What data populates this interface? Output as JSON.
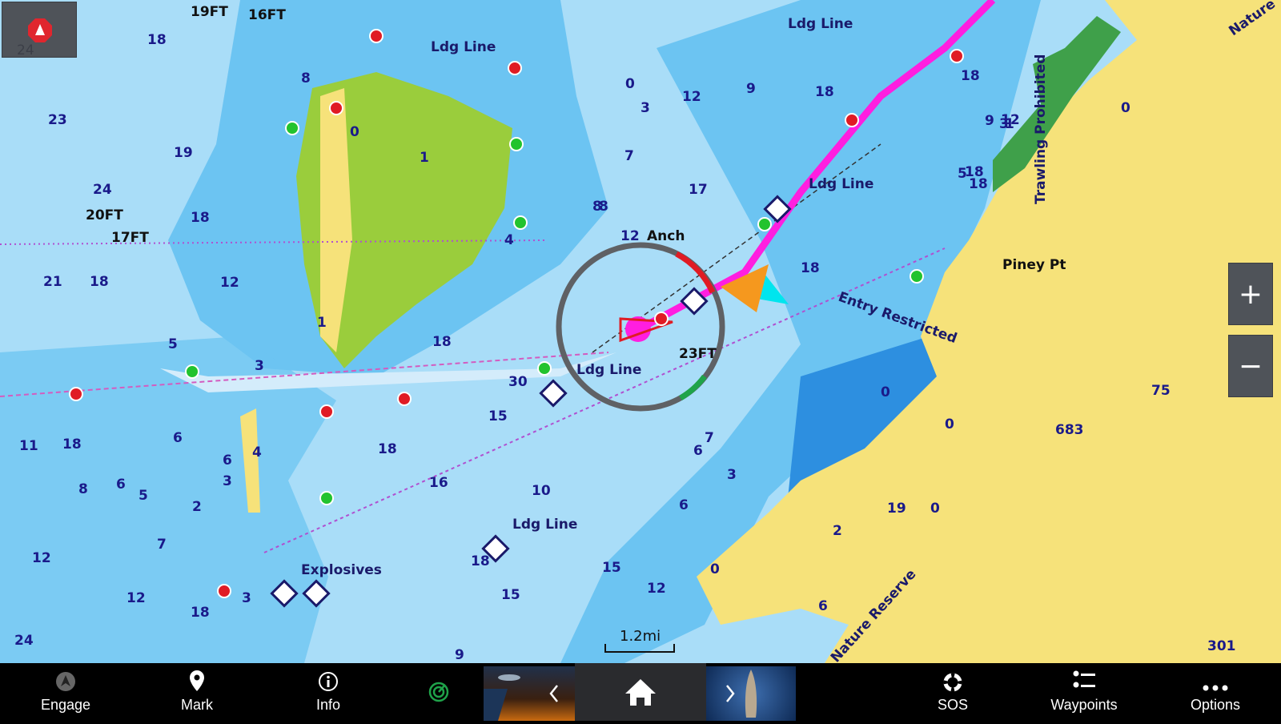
{
  "map": {
    "soundings": [
      "18",
      "23",
      "19",
      "24",
      "18",
      "21",
      "18",
      "12",
      "8",
      "8",
      "1",
      "0",
      "3",
      "0",
      "7",
      "12",
      "9",
      "18",
      "8",
      "17",
      "12",
      "18",
      "9",
      "12",
      "3",
      "18",
      "5",
      "1",
      "0",
      "4",
      "5",
      "3",
      "1",
      "18",
      "15",
      "30",
      "18",
      "6",
      "11",
      "18",
      "8",
      "6",
      "5",
      "4",
      "6",
      "3",
      "2",
      "7",
      "12",
      "12",
      "24",
      "18",
      "16",
      "10",
      "6",
      "7",
      "6",
      "15",
      "12",
      "15",
      "18",
      "9",
      "3",
      "18",
      "0",
      "0",
      "19",
      "0",
      "683",
      "75",
      "301",
      "6",
      "3",
      "0",
      "2",
      "18"
    ],
    "depth_ft_labels": [
      "19FT",
      "16FT",
      "20FT",
      "17FT",
      "23FT"
    ],
    "feature_labels": {
      "ldg_line_1": "Ldg Line",
      "ldg_line_2": "Ldg Line",
      "ldg_line_3": "Ldg Line",
      "ldg_line_4": "Ldg Line",
      "ldg_line_5": "Ldg Line",
      "anch": "Anch",
      "explosives": "Explosives",
      "entry_restricted": "Entry Restricted",
      "piney_pt": "Piney Pt",
      "trawling_prohibited": "Trawling Prohibited",
      "nature_reserve": "Nature Reserve",
      "nature_top": "Nature"
    },
    "scale": "1.2mi",
    "ghost_depth": "24",
    "colors": {
      "land": "#f6e27a",
      "shallow": "#6cc4f2",
      "deep": "#a9ddf8",
      "marsh": "#9acd3c",
      "route": "#ff1ee0",
      "starboard": "#e01b24",
      "port": "#22c32e"
    }
  },
  "controls": {
    "zoom_in": "+",
    "zoom_out": "−",
    "north_up_icon": "north-up-icon"
  },
  "toolbar": {
    "engage": "Engage",
    "mark": "Mark",
    "info": "Info",
    "sos": "SOS",
    "waypoints": "Waypoints",
    "options": "Options"
  }
}
